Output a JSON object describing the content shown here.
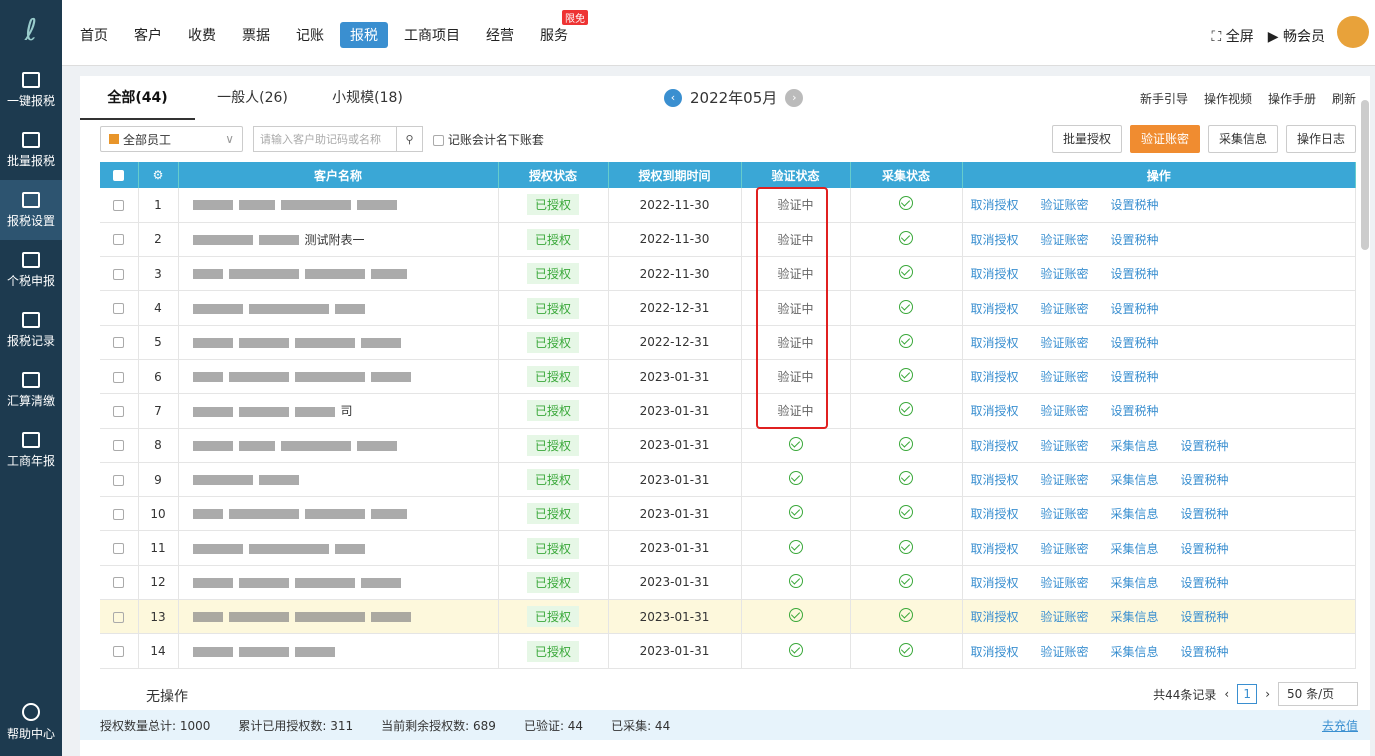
{
  "sidebar": {
    "items": [
      {
        "label": "一键报税",
        "icon": "screen-icon"
      },
      {
        "label": "批量报税",
        "icon": "screen-icon"
      },
      {
        "label": "报税设置",
        "icon": "screen-icon",
        "active": true
      },
      {
        "label": "个税申报",
        "icon": "person-tax-icon"
      },
      {
        "label": "报税记录",
        "icon": "tax-record-icon"
      },
      {
        "label": "汇算清缴",
        "icon": "calc-icon"
      },
      {
        "label": "工商年报",
        "icon": "calendar-icon"
      }
    ],
    "help": "帮助中心"
  },
  "topnav": {
    "items": [
      "首页",
      "客户",
      "收费",
      "票据",
      "记账",
      "报税",
      "工商项目",
      "经营",
      "服务"
    ],
    "badge": "限免",
    "fullscreen": "全屏",
    "member": "畅会员"
  },
  "tabs": [
    "全部(44)",
    "一般人(26)",
    "小规模(18)"
  ],
  "period": "2022年05月",
  "helplinks": [
    "新手引导",
    "操作视频",
    "操作手册",
    "刷新"
  ],
  "filters": {
    "staff": "全部员工",
    "search_placeholder": "请输入客户助记码或名称",
    "checkbox": "记账会计名下账套"
  },
  "actions": [
    "批量授权",
    "验证账密",
    "采集信息",
    "操作日志"
  ],
  "table": {
    "headers": [
      "客户名称",
      "授权状态",
      "授权到期时间",
      "验证状态",
      "采集状态",
      "操作"
    ],
    "rows": [
      {
        "no": "1",
        "auth": "已授权",
        "date": "2022-11-30",
        "verify": "验证中",
        "ops": [
          "取消授权",
          "验证账密",
          "设置税种"
        ]
      },
      {
        "no": "2",
        "name": "测试附表一",
        "auth": "已授权",
        "date": "2022-11-30",
        "verify": "验证中",
        "ops": [
          "取消授权",
          "验证账密",
          "设置税种"
        ]
      },
      {
        "no": "3",
        "auth": "已授权",
        "date": "2022-11-30",
        "verify": "验证中",
        "ops": [
          "取消授权",
          "验证账密",
          "设置税种"
        ]
      },
      {
        "no": "4",
        "auth": "已授权",
        "date": "2022-12-31",
        "verify": "验证中",
        "ops": [
          "取消授权",
          "验证账密",
          "设置税种"
        ]
      },
      {
        "no": "5",
        "auth": "已授权",
        "date": "2022-12-31",
        "verify": "验证中",
        "ops": [
          "取消授权",
          "验证账密",
          "设置税种"
        ]
      },
      {
        "no": "6",
        "auth": "已授权",
        "date": "2023-01-31",
        "verify": "验证中",
        "ops": [
          "取消授权",
          "验证账密",
          "设置税种"
        ]
      },
      {
        "no": "7",
        "name": "司",
        "auth": "已授权",
        "date": "2023-01-31",
        "verify": "验证中",
        "ops": [
          "取消授权",
          "验证账密",
          "设置税种"
        ]
      },
      {
        "no": "8",
        "auth": "已授权",
        "date": "2023-01-31",
        "verify": "",
        "ops": [
          "取消授权",
          "验证账密",
          "采集信息",
          "设置税种"
        ]
      },
      {
        "no": "9",
        "auth": "已授权",
        "date": "2023-01-31",
        "verify": "",
        "ops": [
          "取消授权",
          "验证账密",
          "采集信息",
          "设置税种"
        ]
      },
      {
        "no": "10",
        "auth": "已授权",
        "date": "2023-01-31",
        "verify": "",
        "ops": [
          "取消授权",
          "验证账密",
          "采集信息",
          "设置税种"
        ]
      },
      {
        "no": "11",
        "auth": "已授权",
        "date": "2023-01-31",
        "verify": "",
        "ops": [
          "取消授权",
          "验证账密",
          "采集信息",
          "设置税种"
        ]
      },
      {
        "no": "12",
        "auth": "已授权",
        "date": "2023-01-31",
        "verify": "",
        "ops": [
          "取消授权",
          "验证账密",
          "采集信息",
          "设置税种"
        ]
      },
      {
        "no": "13",
        "auth": "已授权",
        "date": "2023-01-31",
        "verify": "",
        "ops": [
          "取消授权",
          "验证账密",
          "采集信息",
          "设置税种"
        ],
        "highlight": true
      },
      {
        "no": "14",
        "auth": "已授权",
        "date": "2023-01-31",
        "verify": "",
        "ops": [
          "取消授权",
          "验证账密",
          "采集信息",
          "设置税种"
        ]
      }
    ]
  },
  "bottom": {
    "noop": "无操作",
    "total": "共44条记录",
    "page": "1",
    "page_size": "50 条/页"
  },
  "stats": [
    "授权数量总计: 1000",
    "累计已用授权数: 311",
    "当前剩余授权数: 689",
    "已验证: 44",
    "已采集: 44"
  ],
  "charge": "去充值"
}
